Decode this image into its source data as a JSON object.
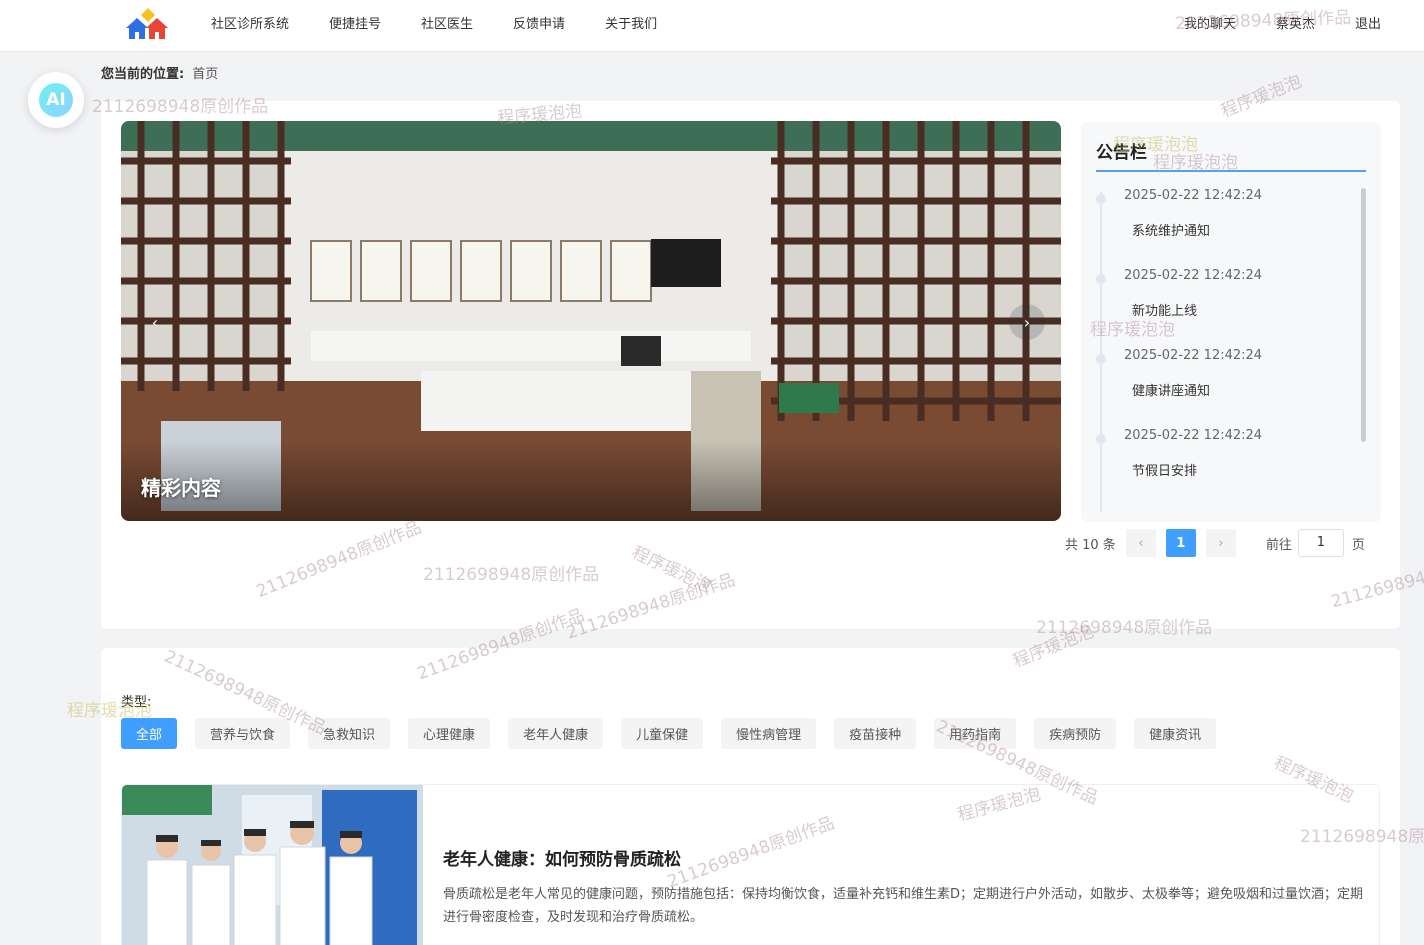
{
  "nav": {
    "items": [
      "社区诊所系统",
      "便捷挂号",
      "社区医生",
      "反馈申请",
      "关于我们"
    ],
    "chat": "我的聊天",
    "user": "蔡英杰",
    "logout": "退出"
  },
  "breadcrumb": {
    "label": "您当前的位置:",
    "current": "首页"
  },
  "ai": {
    "label": "AI"
  },
  "carousel": {
    "caption": "精彩内容",
    "prev": "‹",
    "next": "›"
  },
  "notice": {
    "title": "公告栏",
    "items": [
      {
        "time": "2025-02-22 12:42:24",
        "text": "系统维护通知"
      },
      {
        "time": "2025-02-22 12:42:24",
        "text": "新功能上线"
      },
      {
        "time": "2025-02-22 12:42:24",
        "text": "健康讲座通知"
      },
      {
        "time": "2025-02-22 12:42:24",
        "text": "节假日安排"
      }
    ]
  },
  "pager": {
    "total": "共 10 条",
    "page": "1",
    "goto_prefix": "前往",
    "goto_value": "1",
    "goto_suffix": "页",
    "prev": "‹",
    "next": "›"
  },
  "types": {
    "label": "类型:",
    "items": [
      "全部",
      "营养与饮食",
      "急救知识",
      "心理健康",
      "老年人健康",
      "儿童保健",
      "慢性病管理",
      "疫苗接种",
      "用药指南",
      "疾病预防",
      "健康资讯"
    ]
  },
  "article": {
    "title": "老年人健康：如何预防骨质疏松",
    "desc": "骨质疏松是老年人常见的健康问题，预防措施包括：保持均衡饮食，适量补充钙和维生素D；定期进行户外活动，如散步、太极拳等；避免吸烟和过量饮酒；定期进行骨密度检查，及时发现和治疗骨质疏松。"
  },
  "watermarks": {
    "id_work": "2112698948原创作品",
    "brand": "程序瑗泡泡"
  },
  "colors": {
    "primary": "#409eff",
    "accent_line": "#5aa0f0"
  }
}
